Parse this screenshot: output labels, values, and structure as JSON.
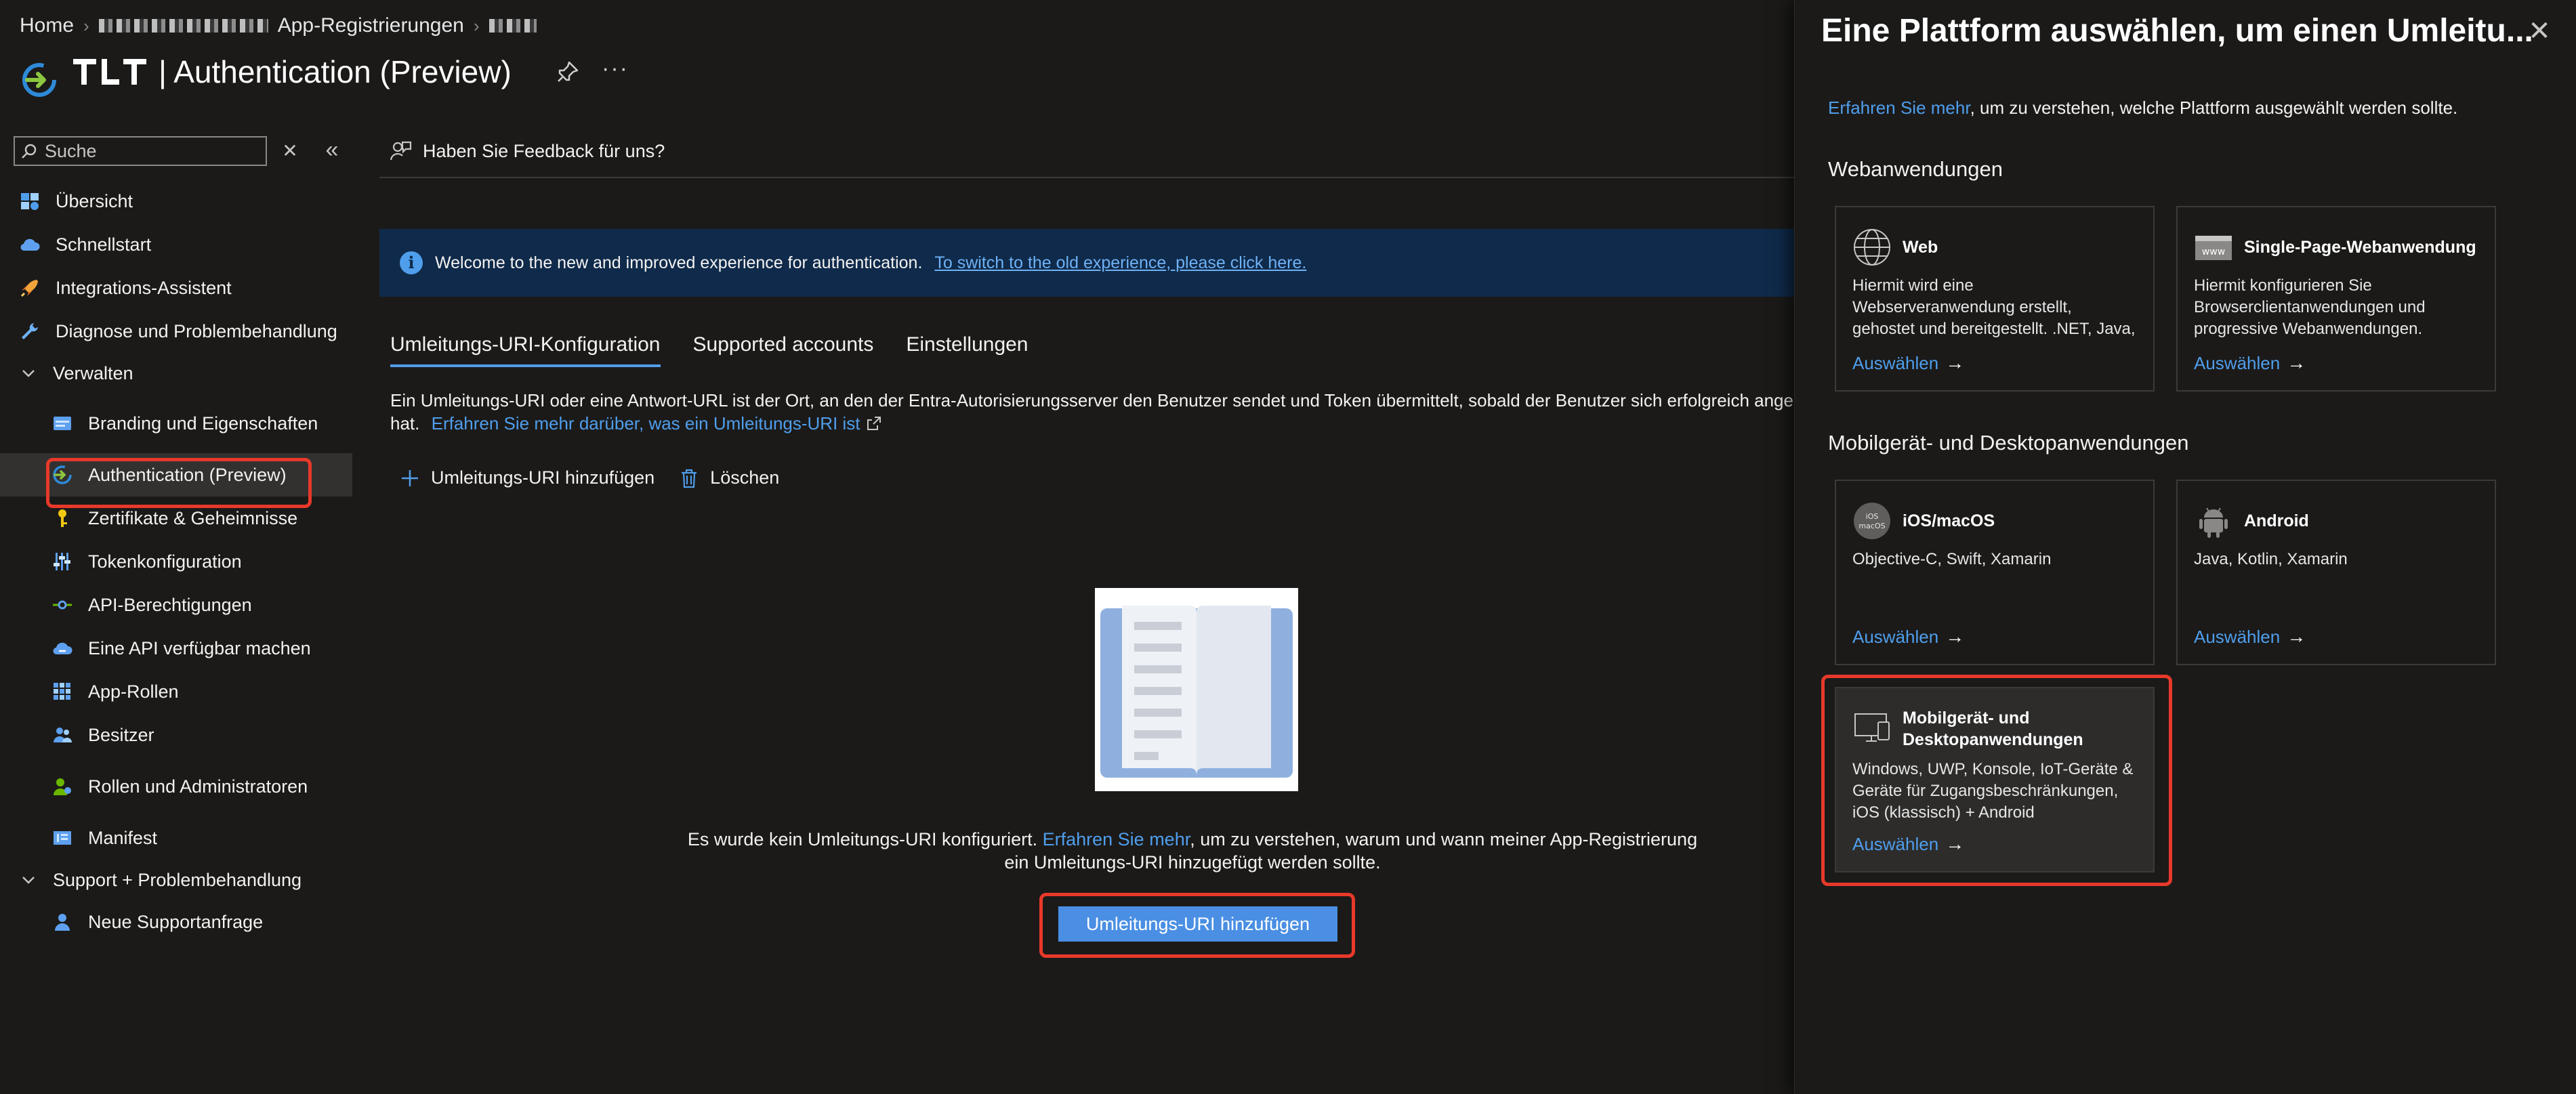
{
  "breadcrumb": {
    "home": "Home",
    "app_registrations": "App-Registrierungen"
  },
  "header": {
    "title": "| Authentication (Preview)"
  },
  "sidebar": {
    "search_placeholder": "Suche",
    "items": [
      {
        "label": "Übersicht",
        "icon": "overview-icon"
      },
      {
        "label": "Schnellstart",
        "icon": "cloud-icon"
      },
      {
        "label": "Integrations-Assistent",
        "icon": "rocket-icon"
      },
      {
        "label": "Diagnose und Problembehandlung",
        "icon": "wrench-icon"
      },
      {
        "label": "Verwalten",
        "icon": "chevron-down-icon"
      },
      {
        "label": "Branding und Eigenschaften",
        "icon": "branding-icon"
      },
      {
        "label": "Authentication (Preview)",
        "icon": "authentication-icon"
      },
      {
        "label": "Zertifikate & Geheimnisse",
        "icon": "key-icon"
      },
      {
        "label": "Tokenkonfiguration",
        "icon": "sliders-icon"
      },
      {
        "label": "API-Berechtigungen",
        "icon": "api-permissions-icon"
      },
      {
        "label": "Eine API verfügbar machen",
        "icon": "cloud-api-icon"
      },
      {
        "label": "App-Rollen",
        "icon": "grid-icon"
      },
      {
        "label": "Besitzer",
        "icon": "people-icon"
      },
      {
        "label": "Rollen und Administratoren",
        "icon": "admin-icon"
      },
      {
        "label": "Manifest",
        "icon": "manifest-icon"
      },
      {
        "label": "Support + Problembehandlung",
        "icon": "chevron-down-icon"
      },
      {
        "label": "Neue Supportanfrage",
        "icon": "person-icon"
      }
    ]
  },
  "main": {
    "feedback": "Haben Sie Feedback für uns?",
    "banner": {
      "text": "Welcome to the new and improved experience for authentication.",
      "link": "To switch to the old experience, please click here."
    },
    "tabs": [
      "Umleitungs-URI-Konfiguration",
      "Supported accounts",
      "Einstellungen"
    ],
    "description_1": "Ein Umleitungs-URI oder eine Antwort-URL ist der Ort, an den der Entra-Autorisierungsserver den Benutzer sendet und Token übermittelt, sobald der Benutzer sich erfolgreich angen",
    "description_2": "hat.",
    "description_link": "Erfahren Sie mehr darüber, was ein Umleitungs-URI ist",
    "toolbar": {
      "add": "Umleitungs-URI hinzufügen",
      "delete": "Löschen"
    },
    "empty_text_1": "Es wurde kein Umleitungs-URI konfiguriert.",
    "empty_link": "Erfahren Sie mehr",
    "empty_text_2": ", um zu verstehen, warum und wann meiner App-Registrierung",
    "empty_text_3": "ein Umleitungs-URI hinzugefügt werden sollte.",
    "primary_button": "Umleitungs-URI hinzufügen"
  },
  "panel": {
    "title": "Eine Plattform auswählen, um einen Umleitu...",
    "intro_link": "Erfahren Sie mehr",
    "intro_text": ", um zu verstehen, welche Plattform ausgewählt werden sollte.",
    "section_web": "Webanwendungen",
    "section_mobile": "Mobilgerät- und Desktopanwendungen",
    "select_label": "Auswählen",
    "cards": [
      {
        "title": "Web",
        "desc": "Hiermit wird eine Webserveranwendung erstellt, gehostet und bereitgestellt. .NET, Java, Python",
        "icon": "globe-icon"
      },
      {
        "title": "Single-Page-Webanwendung",
        "desc": "Hiermit konfigurieren Sie Browserclientanwendungen und progressive Webanwendungen. JavaScript",
        "icon": "www-icon"
      },
      {
        "title": "iOS/macOS",
        "desc": "Objective-C, Swift, Xamarin",
        "icon": "ios-macos-icon"
      },
      {
        "title": "Android",
        "desc": "Java, Kotlin, Xamarin",
        "icon": "android-icon"
      },
      {
        "title": "Mobilgerät- und Desktopanwendungen",
        "desc": "Windows, UWP, Konsole, IoT-Geräte & Geräte für Zugangsbeschränkungen, iOS (klassisch) + Android",
        "icon": "desktop-icon"
      }
    ]
  },
  "colors": {
    "background": "#1b1a19",
    "accent": "#4f9eec",
    "primary_button": "#4a8fe3",
    "highlight": "#e8392a",
    "banner": "#0f2a4a"
  }
}
